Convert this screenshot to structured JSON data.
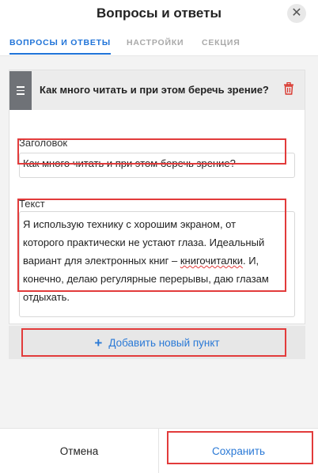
{
  "header": {
    "title": "Вопросы и ответы",
    "close_glyph": "✕"
  },
  "tabs": [
    {
      "label": "ВОПРОСЫ И ОТВЕТЫ",
      "active": true
    },
    {
      "label": "НАСТРОЙКИ",
      "active": false
    },
    {
      "label": "СЕКЦИЯ",
      "active": false
    }
  ],
  "item": {
    "title": "Как много читать и при этом беречь зрение?",
    "heading_label": "Заголовок",
    "heading_value": "Как много читать и при этом беречь зрение?",
    "text_label": "Текст",
    "text_value_part1": "Я использую технику с хорошим экраном, от которого практически не устают глаза. Идеальный вариант для электронных книг – ",
    "text_value_misspelled": "книгочиталки",
    "text_value_part2": ". И, конечно, делаю регулярные перерывы, даю глазам отдыхать."
  },
  "add_button": {
    "icon": "+",
    "label": "Добавить новый пункт"
  },
  "footer": {
    "cancel_label": "Отмена",
    "save_label": "Сохранить"
  },
  "colors": {
    "accent": "#1f73d8",
    "highlight": "#e23b3b",
    "delete": "#d9342b"
  },
  "icons": {
    "drag": "drag-handle-icon",
    "delete": "trash-icon",
    "close": "close-icon",
    "add": "plus-icon"
  }
}
